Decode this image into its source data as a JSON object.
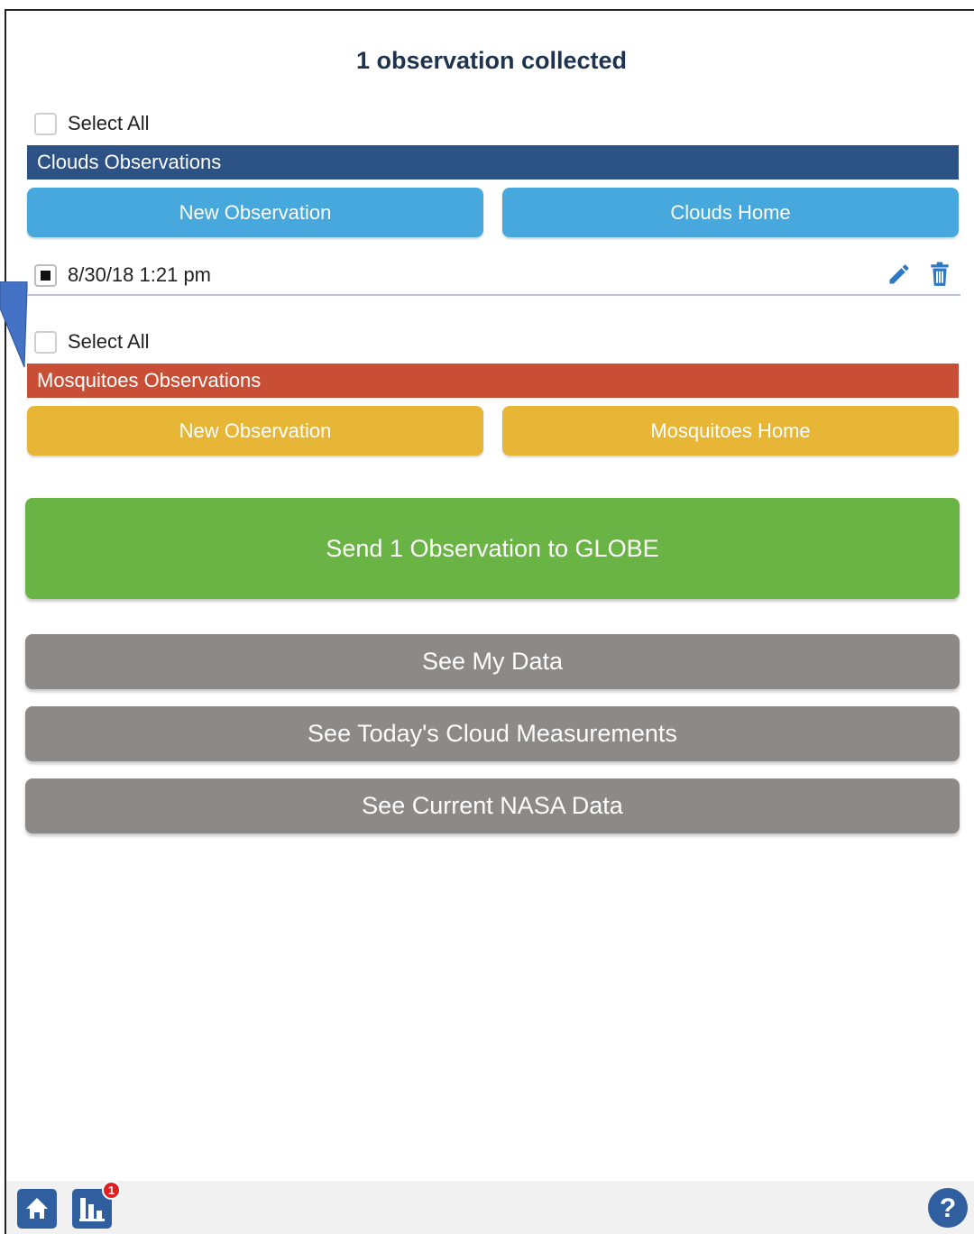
{
  "header": {
    "title": "1 observation collected"
  },
  "clouds": {
    "select_all_label": "Select All",
    "section_title": "Clouds Observations",
    "new_observation_label": "New Observation",
    "home_label": "Clouds Home",
    "bar_color": "#2d5286",
    "button_color": "#47a8dd",
    "observations": [
      {
        "datetime": "8/30/18 1:21 pm",
        "checked": true
      }
    ]
  },
  "mosquitoes": {
    "select_all_label": "Select All",
    "section_title": "Mosquitoes Observations",
    "new_observation_label": "New Observation",
    "home_label": "Mosquitoes Home",
    "bar_color": "#c84e35",
    "button_color": "#e7b637"
  },
  "actions": {
    "send_label": "Send 1 Observation to GLOBE",
    "send_color": "#6ab446",
    "see_my_data_label": "See My Data",
    "see_today_label": "See Today's Cloud Measurements",
    "see_nasa_label": "See Current NASA Data",
    "grey_color": "#8c8986"
  },
  "footer": {
    "home_icon": "home-icon",
    "data_icon": "bar-chart-icon",
    "data_badge_count": "1",
    "help_icon": "help-icon"
  }
}
